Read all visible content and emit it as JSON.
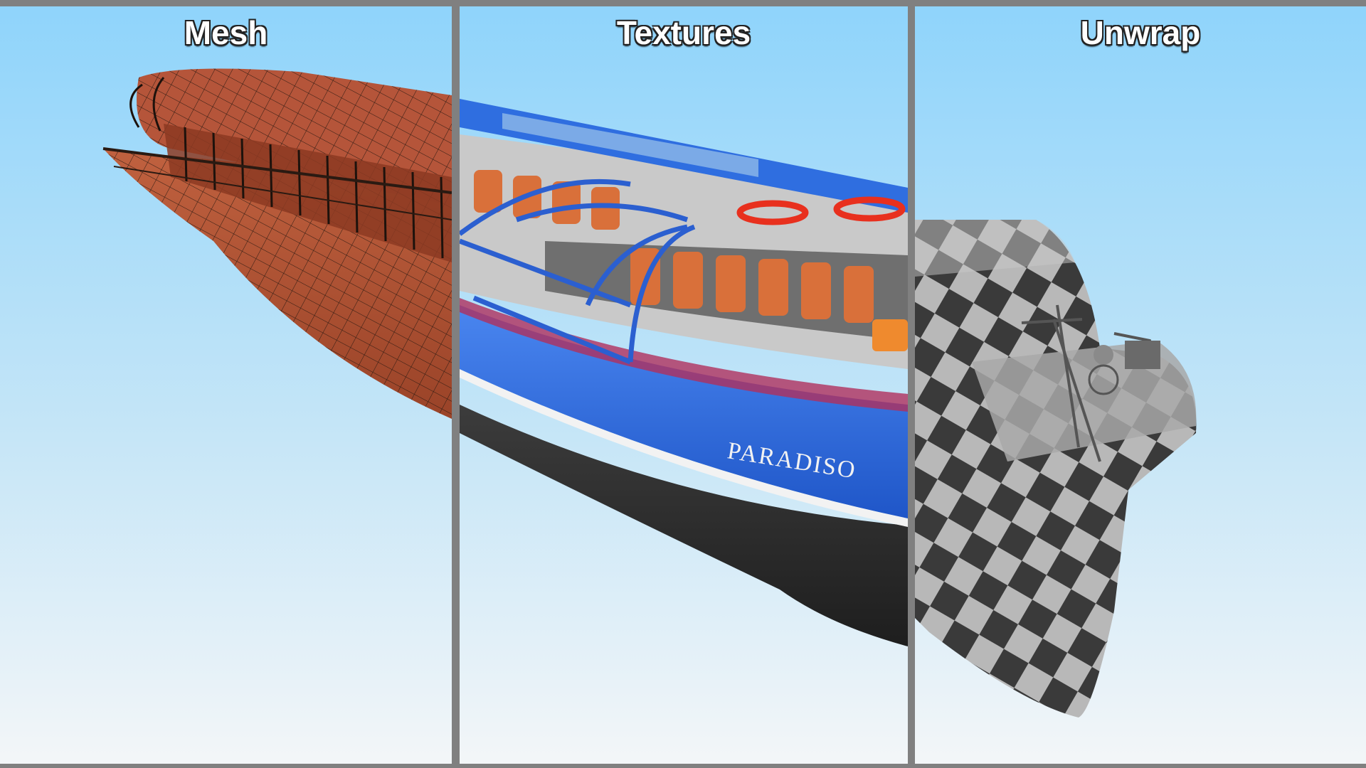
{
  "panels": [
    {
      "title": "Mesh"
    },
    {
      "title": "Textures"
    },
    {
      "title": "Unwrap"
    }
  ],
  "boat": {
    "name": "PARADISO"
  },
  "colors": {
    "background": "#808080",
    "sky_top": "#8fd4fb",
    "sky_bottom": "#f3f6f8",
    "mesh_hull": "#b8573a",
    "textured_hull": "#2f6ee0",
    "hull_black": "#2a2a2a",
    "seats": "#d9703a",
    "checker_dark": "#3a3a3a",
    "checker_light": "#b8b8b8"
  }
}
